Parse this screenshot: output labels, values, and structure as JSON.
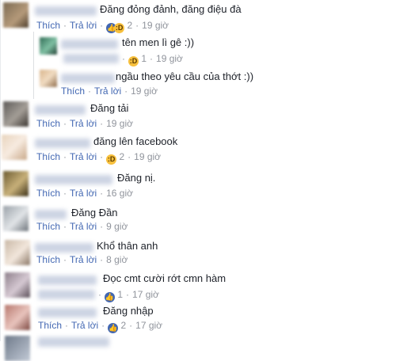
{
  "comments": [
    {
      "text": "Đăng đỏng đảnh, đăng điệu đà",
      "like_label": "Thích",
      "reply_label": "Trả lời",
      "reaction_count": "2",
      "time": "19 giờ",
      "reactions": [
        "like-icon",
        "haha-icon"
      ]
    },
    {
      "text": "tên men lì gê :))",
      "reaction_count": "1",
      "time": "19 giờ",
      "reactions": [
        "haha-icon"
      ]
    },
    {
      "text": "ngầu theo yêu cầu của thớt :))",
      "like_label": "Thích",
      "reply_label": "Trả lời",
      "time": "19 giờ"
    },
    {
      "text": "Đăng tải",
      "like_label": "Thích",
      "reply_label": "Trả lời",
      "time": "19 giờ"
    },
    {
      "text": "đăng lên facebook",
      "like_label": "Thích",
      "reply_label": "Trả lời",
      "reaction_count": "2",
      "time": "19 giờ",
      "reactions": [
        "haha-icon"
      ]
    },
    {
      "text": "Đăng nị.",
      "like_label": "Thích",
      "reply_label": "Trả lời",
      "time": "16 giờ"
    },
    {
      "text": "Đăng Đần",
      "like_label": "Thích",
      "reply_label": "Trả lời",
      "time": "9 giờ"
    },
    {
      "text": "Khổ thân anh",
      "like_label": "Thích",
      "reply_label": "Trả lời",
      "time": "8 giờ"
    },
    {
      "text": "Đọc cmt cười rớt cmn hàm",
      "reaction_count": "1",
      "time": "17 giờ",
      "reactions": [
        "like-icon"
      ]
    },
    {
      "text": "Đăng nhập",
      "like_label": "Thích",
      "reply_label": "Trả lời",
      "reaction_count": "2",
      "time": "17 giờ",
      "reactions": [
        "like-icon"
      ]
    }
  ],
  "separator": "·",
  "colors": {
    "link": "#4267b2",
    "meta": "#90949c",
    "text": "#1d2129",
    "haha": "#f7c03d"
  }
}
